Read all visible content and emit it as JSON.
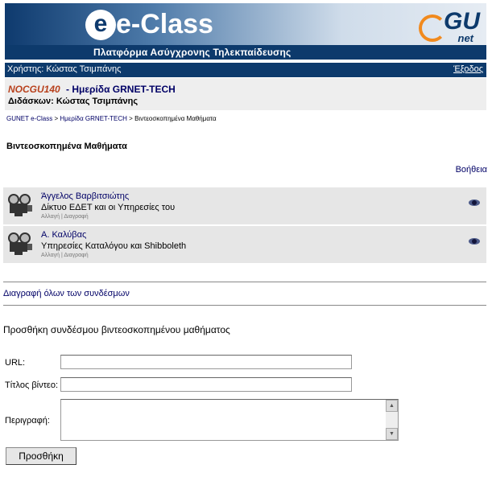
{
  "header": {
    "logo_text": "e-Class",
    "tagline": "Πλατφόρμα Ασύγχρονης Τηλεκπαίδευσης",
    "partner_logo_text": "GU",
    "partner_logo_sub": "net",
    "colors": {
      "dark_blue": "#0d3a6c",
      "orange": "#f18a1e"
    }
  },
  "userbar": {
    "user_label": "Χρήστης: Κώστας Τσιμπάνης",
    "logout": "Έξοδος"
  },
  "course": {
    "code": "NOCGU140",
    "name": "- Ημερίδα GRNET-TECH",
    "professor": "Διδάσκων: Κώστας Τσιμπάνης",
    "code_color": "#b8411d"
  },
  "breadcrumb": {
    "home": "GUNET e-Class",
    "course": "Ημερίδα GRNET-TECH",
    "current": "Βιντεοσκοπημένα Μαθήματα",
    "sep": ">"
  },
  "page": {
    "title": "Βιντεοσκοπημένα Μαθήματα",
    "help": "Βοήθεια"
  },
  "videos": [
    {
      "author": "Άγγελος Βαρβιτσιώτης",
      "title": "Δίκτυο ΕΔΕΤ και οι Υπηρεσίες του",
      "edit": "Αλλαγή",
      "delete": "Διαγραφή"
    },
    {
      "author": "Α. Καλύβας",
      "title": "Υπηρεσίες Καταλόγου και Shibboleth",
      "edit": "Αλλαγή",
      "delete": "Διαγραφή"
    }
  ],
  "actions_sep": "|",
  "delete_all": "Διαγραφή όλων των συνδέσμων",
  "form": {
    "heading": "Προσθήκη συνδέσμου βιντεοσκοπημένου μαθήματος",
    "url_label": "URL:",
    "url_value": "",
    "title_label": "Τίτλος βίντεο:",
    "title_value": "",
    "desc_label": "Περιγραφή:",
    "desc_value": "",
    "submit": "Προσθήκη"
  }
}
